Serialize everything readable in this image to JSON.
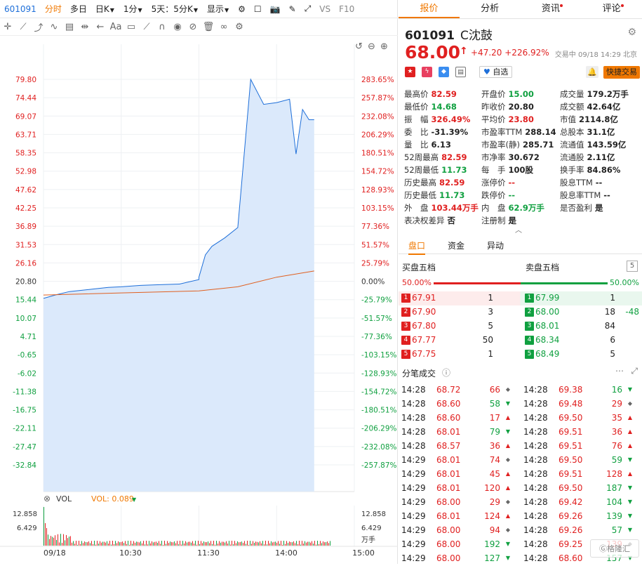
{
  "topbar": {
    "code": "601091",
    "items": [
      "分时",
      "多日",
      "日K",
      "1分",
      "5天：5分K",
      "显示",
      "VS",
      "F10"
    ]
  },
  "chart_axis": {
    "price_ticks": [
      "79.80",
      "74.44",
      "69.07",
      "63.71",
      "58.35",
      "52.98",
      "47.62",
      "42.25",
      "36.89",
      "31.53",
      "26.16",
      "20.80",
      "15.44",
      "10.07",
      "4.71",
      "-0.65",
      "-6.02",
      "-11.38",
      "-16.75",
      "-22.11",
      "-27.47",
      "-32.84"
    ],
    "pct_ticks": [
      "283.65%",
      "257.87%",
      "232.08%",
      "206.29%",
      "180.51%",
      "154.72%",
      "128.93%",
      "103.15%",
      "77.36%",
      "51.57%",
      "25.79%",
      "0.00%",
      "-25.79%",
      "-51.57%",
      "-77.36%",
      "-103.15%",
      "-128.93%",
      "-154.72%",
      "-180.51%",
      "-206.29%",
      "-232.08%",
      "-257.87%"
    ],
    "time_labels": [
      "09/18",
      "10:30",
      "11:30",
      "14:00",
      "15:00"
    ],
    "vol_ticks": [
      "12.858",
      "6.429"
    ],
    "vol_right_ticks": [
      "12.858",
      "6.429",
      "万手"
    ],
    "vol_label": "VOL",
    "vol_value": "VOL: 0.089"
  },
  "chart_data": {
    "type": "line",
    "series": [
      {
        "x": [
          "09:30",
          "09:40",
          "09:50",
          "10:00",
          "10:10",
          "10:20",
          "10:30",
          "10:45",
          "11:00",
          "11:15",
          "11:30",
          "13:00",
          "13:05",
          "13:10",
          "13:20",
          "13:30",
          "13:40",
          "13:50",
          "14:00",
          "14:10",
          "14:15",
          "14:20",
          "14:25",
          "14:29"
        ],
        "values": [
          15.8,
          16.9,
          17.8,
          18.2,
          18.6,
          19.0,
          19.2,
          19.6,
          19.8,
          20.0,
          21.3,
          22.0,
          28.5,
          31.0,
          33.5,
          36.5,
          79.8,
          72.5,
          73.0,
          74.0,
          58.0,
          71.0,
          68.0,
          68.0
        ]
      },
      {
        "x": [
          "09:30",
          "10:30",
          "11:30",
          "13:30",
          "14:00",
          "14:29"
        ],
        "values": [
          16.8,
          17.4,
          18.0,
          19.2,
          22.0,
          23.8
        ]
      }
    ],
    "ylim": [
      -32.84,
      79.8
    ]
  },
  "header": {
    "tabs": [
      "报价",
      "分析",
      "资讯",
      "评论"
    ],
    "code": "601091",
    "name": "C沈鼓",
    "price": "68.00",
    "change": "+47.20",
    "change_pct": "+226.92%",
    "status": "交易中 09/18 14:29 北京",
    "fav": "自选",
    "trade": "快捷交易"
  },
  "quote_rows": [
    [
      [
        "最高价",
        "82.59",
        "red"
      ],
      [
        "开盘价",
        "15.00",
        "green"
      ],
      [
        "成交量",
        "179.2万手",
        "dark"
      ]
    ],
    [
      [
        "最低价",
        "14.68",
        "green"
      ],
      [
        "昨收价",
        "20.80",
        "dark"
      ],
      [
        "成交额",
        "42.64亿",
        "dark"
      ]
    ],
    [
      [
        "振　幅",
        "326.49%",
        "red"
      ],
      [
        "平均价",
        "23.80",
        "red"
      ],
      [
        "市值",
        "2114.8亿",
        "dark"
      ]
    ],
    [
      [
        "委　比",
        "-31.39%",
        "dark"
      ],
      [
        "市盈率TTM",
        "288.14",
        "dark"
      ],
      [
        "总股本",
        "31.1亿",
        "dark"
      ]
    ],
    [
      [
        "量　比",
        "6.13",
        "dark"
      ],
      [
        "市盈率(静)",
        "285.71",
        "dark"
      ],
      [
        "流通值",
        "143.59亿",
        "dark"
      ]
    ],
    [
      [
        "52周最高",
        "82.59",
        "red"
      ],
      [
        "市净率",
        "30.672",
        "dark"
      ],
      [
        "流通股",
        "2.11亿",
        "dark"
      ]
    ],
    [
      [
        "52周最低",
        "11.73",
        "green"
      ],
      [
        "每　手",
        "100股",
        "dark"
      ],
      [
        "换手率",
        "84.86%",
        "dark"
      ]
    ],
    [
      [
        "历史最高",
        "82.59",
        "red"
      ],
      [
        "涨停价",
        "--",
        "red"
      ],
      [
        "股息TTM",
        "--",
        "dark"
      ]
    ],
    [
      [
        "历史最低",
        "11.73",
        "green"
      ],
      [
        "跌停价",
        "--",
        "green"
      ],
      [
        "股息率TTM",
        "--",
        "dark"
      ]
    ],
    [
      [
        "外　盘",
        "103.44万手",
        "red"
      ],
      [
        "内　盘",
        "62.9万手",
        "green"
      ],
      [
        "是否盈利",
        "是",
        "dark"
      ]
    ],
    [
      [
        "表决权差异",
        "否",
        "dark"
      ],
      [
        "注册制",
        "是",
        "dark"
      ]
    ]
  ],
  "subtabs": [
    "盘口",
    "资金",
    "异动"
  ],
  "orderbook": {
    "buy_title": "买盘五档",
    "sell_title": "卖盘五档",
    "depth": "5",
    "buy_ratio": "50.00%",
    "sell_ratio": "50.00%",
    "rows": [
      {
        "n": "1",
        "bp": "67.91",
        "bv": "1",
        "sp": "67.99",
        "sv": "1",
        "d": ""
      },
      {
        "n": "2",
        "bp": "67.90",
        "bv": "3",
        "sp": "68.00",
        "sv": "18",
        "d": "-48"
      },
      {
        "n": "3",
        "bp": "67.80",
        "bv": "5",
        "sp": "68.01",
        "sv": "84",
        "d": ""
      },
      {
        "n": "4",
        "bp": "67.77",
        "bv": "50",
        "sp": "68.34",
        "sv": "6",
        "d": ""
      },
      {
        "n": "5",
        "bp": "67.75",
        "bv": "1",
        "sp": "68.49",
        "sv": "5",
        "d": ""
      }
    ]
  },
  "ticks_title": "分笔成交",
  "ticks": [
    [
      [
        "14:28",
        "68.72",
        "66",
        "n"
      ],
      [
        "14:28",
        "69.38",
        "16",
        "d"
      ]
    ],
    [
      [
        "14:28",
        "68.60",
        "58",
        "d"
      ],
      [
        "14:28",
        "69.48",
        "29",
        "n"
      ]
    ],
    [
      [
        "14:28",
        "68.60",
        "17",
        "u"
      ],
      [
        "14:28",
        "69.50",
        "35",
        "u"
      ]
    ],
    [
      [
        "14:28",
        "68.01",
        "79",
        "d"
      ],
      [
        "14:28",
        "69.51",
        "36",
        "u"
      ]
    ],
    [
      [
        "14:28",
        "68.57",
        "36",
        "u"
      ],
      [
        "14:28",
        "69.51",
        "76",
        "u"
      ]
    ],
    [
      [
        "14:29",
        "68.01",
        "74",
        "n"
      ],
      [
        "14:28",
        "69.50",
        "59",
        "d"
      ]
    ],
    [
      [
        "14:29",
        "68.01",
        "45",
        "u"
      ],
      [
        "14:28",
        "69.51",
        "128",
        "u"
      ]
    ],
    [
      [
        "14:29",
        "68.01",
        "120",
        "u"
      ],
      [
        "14:28",
        "69.50",
        "187",
        "d"
      ]
    ],
    [
      [
        "14:29",
        "68.00",
        "29",
        "n"
      ],
      [
        "14:28",
        "69.42",
        "104",
        "d"
      ]
    ],
    [
      [
        "14:29",
        "68.01",
        "124",
        "u"
      ],
      [
        "14:28",
        "69.26",
        "139",
        "d"
      ]
    ],
    [
      [
        "14:29",
        "68.00",
        "94",
        "n"
      ],
      [
        "14:28",
        "69.26",
        "57",
        "d"
      ]
    ],
    [
      [
        "14:29",
        "68.00",
        "192",
        "d"
      ],
      [
        "14:28",
        "69.25",
        "139",
        "n"
      ]
    ],
    [
      [
        "14:29",
        "68.00",
        "127",
        "d"
      ],
      [
        "14:28",
        "68.60",
        "157",
        "d"
      ]
    ]
  ],
  "colors": {
    "up": "#e02020",
    "down": "#10a040",
    "accent": "#f07800",
    "line": "#1e6fd9",
    "avg": "#e06020"
  }
}
